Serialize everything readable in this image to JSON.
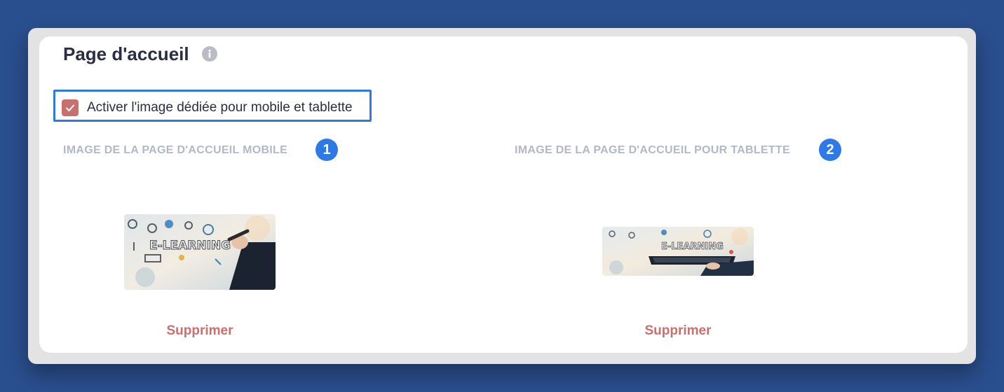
{
  "section": {
    "title": "Page d'accueil",
    "info_icon": "info-icon"
  },
  "toggle": {
    "label": "Activer l'image dédiée pour mobile et tablette",
    "checked": true,
    "accent_color": "#c96f6c",
    "highlight_color": "#2d7ae6"
  },
  "mobile": {
    "label": "IMAGE DE LA PAGE D'ACCUEIL MOBILE",
    "badge": "1",
    "image_text": "E-LEARNING",
    "delete_label": "Supprimer"
  },
  "tablet": {
    "label": "IMAGE DE LA PAGE D'ACCUEIL POUR TABLETTE",
    "badge": "2",
    "image_text": "E-LEARNING",
    "delete_label": "Supprimer"
  }
}
